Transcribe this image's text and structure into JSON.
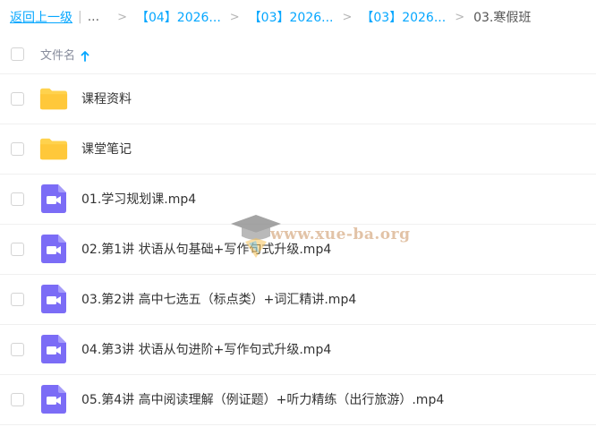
{
  "breadcrumb": {
    "back_label": "返回上一级",
    "pipe": "|",
    "ellipsis": "...",
    "separator": ">",
    "items": [
      "【04】2026...",
      "【03】2026...",
      "【03】2026..."
    ],
    "current": "03.寒假班"
  },
  "header": {
    "column_label": "文件名",
    "sort": "ascending"
  },
  "files": [
    {
      "name": "课程资料",
      "type": "folder"
    },
    {
      "name": "课堂笔记",
      "type": "folder"
    },
    {
      "name": "01.学习规划课.mp4",
      "type": "video"
    },
    {
      "name": "02.第1讲 状语从句基础+写作句式升级.mp4",
      "type": "video"
    },
    {
      "name": "03.第2讲 高中七选五（标点类）+词汇精讲.mp4",
      "type": "video"
    },
    {
      "name": "04.第3讲 状语从句进阶+写作句式升级.mp4",
      "type": "video"
    },
    {
      "name": "05.第4讲 高中阅读理解（例证题）+听力精练（出行旅游）.mp4",
      "type": "video"
    }
  ],
  "watermark": {
    "text": "www.xue-ba.org"
  },
  "colors": {
    "link": "#06a7ff",
    "folder": "#ffd24d",
    "video": "#7b6cf6"
  },
  "icons": {
    "folder": "folder-icon",
    "video": "video-file-icon",
    "sort": "sort-ascending-icon"
  }
}
